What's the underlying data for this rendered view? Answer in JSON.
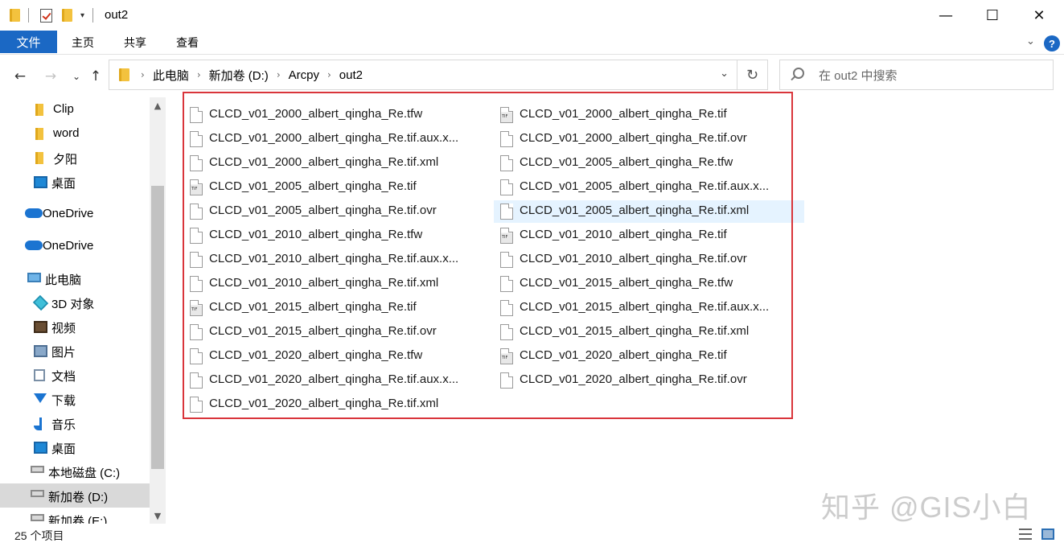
{
  "window": {
    "title": "out2",
    "minimize_glyph": "—",
    "maximize_glyph": "☐",
    "close_glyph": "✕"
  },
  "ribbon": {
    "tabs": [
      "文件",
      "主页",
      "共享",
      "查看"
    ],
    "help_glyph": "?"
  },
  "nav": {
    "breadcrumbs": [
      "此电脑",
      "新加卷 (D:)",
      "Arcpy",
      "out2"
    ],
    "search_placeholder": "在 out2 中搜索"
  },
  "sidebar": {
    "items": [
      {
        "label": "Clip",
        "icon": "folder-icon"
      },
      {
        "label": "word",
        "icon": "folder-icon"
      },
      {
        "label": "夕阳",
        "icon": "folder-icon"
      },
      {
        "label": "桌面",
        "icon": "desktop-icon"
      },
      {
        "label": "OneDrive",
        "icon": "onedrive-icon"
      },
      {
        "label": "OneDrive",
        "icon": "onedrive-icon"
      },
      {
        "label": "此电脑",
        "icon": "this-pc-icon"
      },
      {
        "label": "3D 对象",
        "icon": "3d-objects-icon"
      },
      {
        "label": "视频",
        "icon": "videos-icon"
      },
      {
        "label": "图片",
        "icon": "pictures-icon"
      },
      {
        "label": "文档",
        "icon": "documents-icon"
      },
      {
        "label": "下载",
        "icon": "downloads-icon"
      },
      {
        "label": "音乐",
        "icon": "music-icon"
      },
      {
        "label": "桌面",
        "icon": "desktop-icon"
      },
      {
        "label": "本地磁盘 (C:)",
        "icon": "drive-c-icon"
      },
      {
        "label": "新加卷 (D:)",
        "icon": "drive-icon",
        "selected": true
      },
      {
        "label": "新加卷 (E:)",
        "icon": "drive-icon"
      }
    ]
  },
  "files": [
    {
      "name": "CLCD_v01_2000_albert_qingha_Re.tfw",
      "type": "generic"
    },
    {
      "name": "CLCD_v01_2000_albert_qingha_Re.tif",
      "type": "tif"
    },
    {
      "name": "CLCD_v01_2000_albert_qingha_Re.tif.aux.x...",
      "type": "generic"
    },
    {
      "name": "CLCD_v01_2000_albert_qingha_Re.tif.ovr",
      "type": "generic"
    },
    {
      "name": "CLCD_v01_2000_albert_qingha_Re.tif.xml",
      "type": "generic"
    },
    {
      "name": "CLCD_v01_2005_albert_qingha_Re.tfw",
      "type": "generic"
    },
    {
      "name": "CLCD_v01_2005_albert_qingha_Re.tif",
      "type": "tif"
    },
    {
      "name": "CLCD_v01_2005_albert_qingha_Re.tif.aux.x...",
      "type": "generic"
    },
    {
      "name": "CLCD_v01_2005_albert_qingha_Re.tif.ovr",
      "type": "generic"
    },
    {
      "name": "CLCD_v01_2005_albert_qingha_Re.tif.xml",
      "type": "generic",
      "hover": true
    },
    {
      "name": "CLCD_v01_2010_albert_qingha_Re.tfw",
      "type": "generic"
    },
    {
      "name": "CLCD_v01_2010_albert_qingha_Re.tif",
      "type": "tif"
    },
    {
      "name": "CLCD_v01_2010_albert_qingha_Re.tif.aux.x...",
      "type": "generic"
    },
    {
      "name": "CLCD_v01_2010_albert_qingha_Re.tif.ovr",
      "type": "generic"
    },
    {
      "name": "CLCD_v01_2010_albert_qingha_Re.tif.xml",
      "type": "generic"
    },
    {
      "name": "CLCD_v01_2015_albert_qingha_Re.tfw",
      "type": "generic"
    },
    {
      "name": "CLCD_v01_2015_albert_qingha_Re.tif",
      "type": "tif"
    },
    {
      "name": "CLCD_v01_2015_albert_qingha_Re.tif.aux.x...",
      "type": "generic"
    },
    {
      "name": "CLCD_v01_2015_albert_qingha_Re.tif.ovr",
      "type": "generic"
    },
    {
      "name": "CLCD_v01_2015_albert_qingha_Re.tif.xml",
      "type": "generic"
    },
    {
      "name": "CLCD_v01_2020_albert_qingha_Re.tfw",
      "type": "generic"
    },
    {
      "name": "CLCD_v01_2020_albert_qingha_Re.tif",
      "type": "tif"
    },
    {
      "name": "CLCD_v01_2020_albert_qingha_Re.tif.aux.x...",
      "type": "generic"
    },
    {
      "name": "CLCD_v01_2020_albert_qingha_Re.tif.ovr",
      "type": "generic"
    },
    {
      "name": "CLCD_v01_2020_albert_qingha_Re.tif.xml",
      "type": "generic"
    }
  ],
  "status": {
    "item_count": "25 个项目"
  },
  "watermark": "知乎 @GIS小白",
  "colors": {
    "accent": "#1b68c4",
    "highlight_box": "#d9353b",
    "hover_row": "#e5f3ff"
  }
}
